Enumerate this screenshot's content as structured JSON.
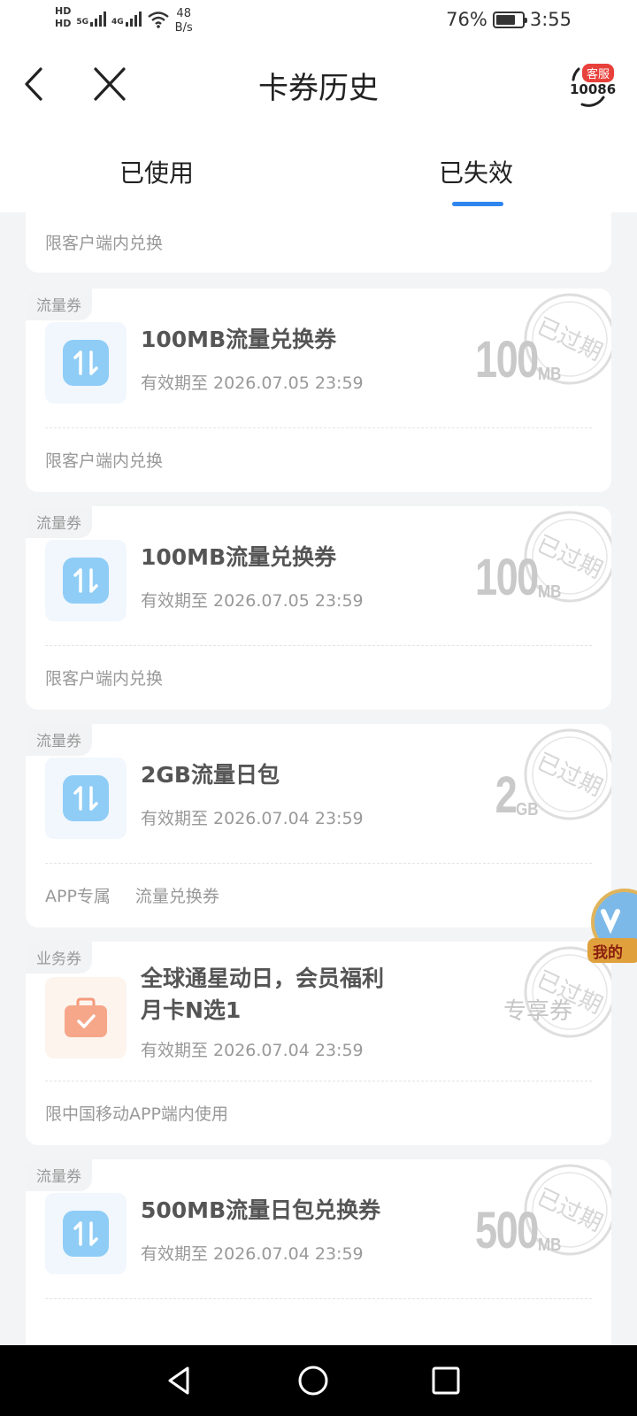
{
  "status_bar": {
    "hd1": "HD",
    "hd2": "HD",
    "net1": "5G",
    "net2": "4G",
    "speed_value": "48",
    "speed_unit": "B/s",
    "battery": "76%",
    "battery_level": 0.76,
    "time": "3:55"
  },
  "header": {
    "title": "卡券历史",
    "service_badge": "客服",
    "service_number": "10086",
    "back_icon": "chevron-left-icon",
    "close_icon": "close-icon"
  },
  "tabs": [
    {
      "label": "已使用",
      "active": false
    },
    {
      "label": "已失效",
      "active": true
    }
  ],
  "colors": {
    "accent": "#2f86ee",
    "stamp": "#d9d9d9",
    "flow_icon": "#7cc0f5",
    "business_icon": "#f49a7c"
  },
  "stamp_text": "已过期",
  "partial_card": {
    "note": "限客户端内兑换"
  },
  "cards": [
    {
      "tag": "流量券",
      "icon": "data-transfer-icon",
      "title": "100MB流量兑换券",
      "valid": "有效期至 2026.07.05 23:59",
      "value": "100",
      "unit": "MB",
      "notes": [
        "限客户端内兑换"
      ]
    },
    {
      "tag": "流量券",
      "icon": "data-transfer-icon",
      "title": "100MB流量兑换券",
      "valid": "有效期至 2026.07.05 23:59",
      "value": "100",
      "unit": "MB",
      "notes": [
        "限客户端内兑换"
      ]
    },
    {
      "tag": "流量券",
      "icon": "data-transfer-icon",
      "title": "2GB流量日包",
      "valid": "有效期至 2026.07.04 23:59",
      "value": "2",
      "unit": "GB",
      "notes": [
        "APP专属",
        "流量兑换券"
      ]
    },
    {
      "tag": "业务券",
      "icon": "briefcase-icon",
      "title_line1": "全球通星动日，会员福利",
      "title_line2": "月卡N选1",
      "valid": "有效期至 2026.07.04 23:59",
      "value_text": "专享券",
      "notes": [
        "限中国移动APP端内使用"
      ]
    },
    {
      "tag": "流量券",
      "icon": "data-transfer-icon",
      "title": "500MB流量日包兑换券",
      "valid": "有效期至 2026.07.04 23:59",
      "value": "500",
      "unit": "MB"
    }
  ],
  "float_badge": {
    "label": "我的"
  },
  "nav": {
    "back_icon": "triangle-back-icon",
    "home_icon": "circle-home-icon",
    "recents_icon": "square-recents-icon"
  }
}
